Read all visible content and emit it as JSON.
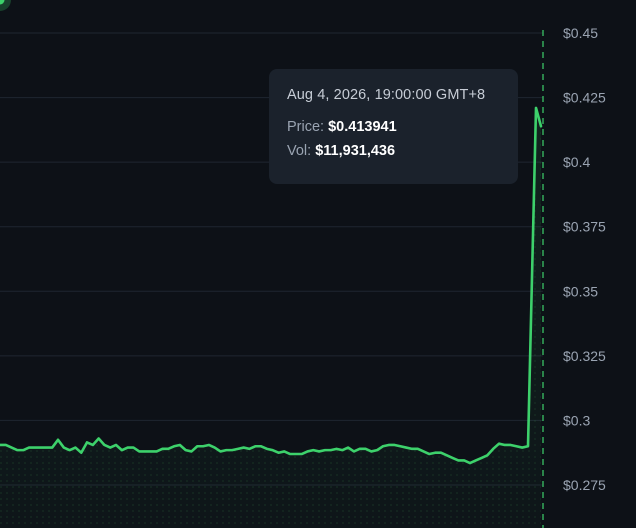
{
  "colors": {
    "background": "#0d1117",
    "line": "#3dd16b",
    "grid": "#1f2631",
    "axis_text": "#9aa4b2",
    "tooltip_bg": "#1b222c"
  },
  "tooltip": {
    "date": "Aug 4, 2026, 19:00:00 GMT+8",
    "price_label": "Price:",
    "price_value": "$0.413941",
    "vol_label": "Vol:",
    "vol_value": "$11,931,436"
  },
  "chart_data": {
    "type": "area",
    "title": "",
    "xlabel": "",
    "ylabel": "",
    "ylim": [
      0.2675,
      0.4575
    ],
    "grid": true,
    "y_axis_position": "right",
    "y_ticks": [
      0.45,
      0.425,
      0.4,
      0.375,
      0.35,
      0.325,
      0.3,
      0.275
    ],
    "y_tick_labels": [
      "$0.45",
      "$0.425",
      "$0.4",
      "$0.375",
      "$0.35",
      "$0.325",
      "$0.3",
      "$0.275"
    ],
    "hover_index": 104,
    "series": [
      {
        "values": [
          0.2905,
          0.2905,
          0.2895,
          0.2885,
          0.2885,
          0.2895,
          0.2895,
          0.2895,
          0.2895,
          0.2895,
          0.2925,
          0.2895,
          0.2885,
          0.2895,
          0.2875,
          0.2915,
          0.2905,
          0.293,
          0.2905,
          0.2895,
          0.2905,
          0.2885,
          0.2895,
          0.2895,
          0.288,
          0.288,
          0.288,
          0.288,
          0.289,
          0.289,
          0.29,
          0.2905,
          0.2885,
          0.288,
          0.29,
          0.29,
          0.2905,
          0.2895,
          0.288,
          0.2885,
          0.2885,
          0.289,
          0.2895,
          0.289,
          0.29,
          0.29,
          0.289,
          0.2885,
          0.2875,
          0.288,
          0.287,
          0.287,
          0.287,
          0.288,
          0.2885,
          0.288,
          0.2885,
          0.2885,
          0.289,
          0.2885,
          0.2895,
          0.288,
          0.289,
          0.289,
          0.288,
          0.2885,
          0.29,
          0.2905,
          0.2905,
          0.29,
          0.2895,
          0.289,
          0.289,
          0.288,
          0.287,
          0.2875,
          0.2875,
          0.2865,
          0.2855,
          0.2845,
          0.2845,
          0.2835,
          0.2845,
          0.2855,
          0.2865,
          0.289,
          0.291,
          0.2905,
          0.2905,
          0.29,
          0.2895,
          0.29,
          0.421,
          0.4139
        ]
      }
    ]
  }
}
